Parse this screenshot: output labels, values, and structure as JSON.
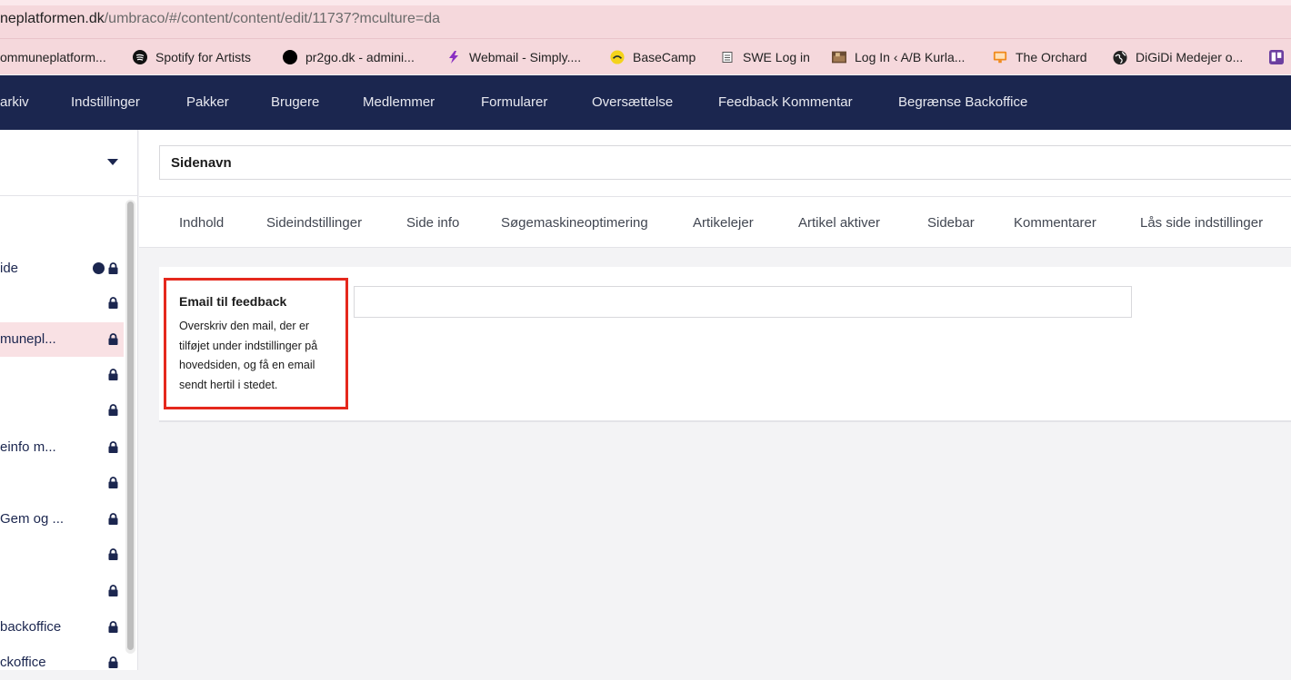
{
  "browser": {
    "url_domain": "neplatformen.dk",
    "url_path": "/umbraco/#/content/content/edit/11737?mculture=da",
    "bookmarks": [
      {
        "label": "ommuneplatform...",
        "icon": "none"
      },
      {
        "label": "Spotify for Artists",
        "icon": "spotify-icon"
      },
      {
        "label": "pr2go.dk - admini...",
        "icon": "black-circle-icon"
      },
      {
        "label": "Webmail - Simply....",
        "icon": "lightning-icon"
      },
      {
        "label": "BaseCamp",
        "icon": "basecamp-icon"
      },
      {
        "label": "SWE Log in",
        "icon": "document-icon"
      },
      {
        "label": "Log In ‹ A/B Kurla...",
        "icon": "photo-icon"
      },
      {
        "label": "The Orchard",
        "icon": "monitor-icon"
      },
      {
        "label": "DiGiDi Medejer o...",
        "icon": "globe-icon"
      }
    ]
  },
  "topnav": {
    "items": [
      "arkiv",
      "Indstillinger",
      "Pakker",
      "Brugere",
      "Medlemmer",
      "Formularer",
      "Oversættelse",
      "Feedback Kommentar",
      "Begrænse Backoffice"
    ]
  },
  "tree": {
    "nodes": [
      {
        "label": "ide",
        "locked": true,
        "globe": true,
        "active": false
      },
      {
        "label": "",
        "locked": true,
        "globe": false,
        "active": false
      },
      {
        "label": "munepl...",
        "locked": true,
        "globe": false,
        "active": true
      },
      {
        "label": "",
        "locked": true,
        "globe": false,
        "active": false
      },
      {
        "label": "",
        "locked": true,
        "globe": false,
        "active": false
      },
      {
        "label": "einfo m...",
        "locked": true,
        "globe": false,
        "active": false
      },
      {
        "label": "",
        "locked": true,
        "globe": false,
        "active": false
      },
      {
        "label": "Gem og ...",
        "locked": true,
        "globe": false,
        "active": false
      },
      {
        "label": "",
        "locked": true,
        "globe": false,
        "active": false
      },
      {
        "label": "",
        "locked": true,
        "globe": false,
        "active": false
      },
      {
        "label": "backoffice",
        "locked": true,
        "globe": false,
        "active": false
      },
      {
        "label": "ckoffice",
        "locked": true,
        "globe": false,
        "active": false
      }
    ]
  },
  "editor": {
    "name_value": "Sidenavn",
    "tabs": [
      "Indhold",
      "Sideindstillinger",
      "Side info",
      "Søgemaskineoptimering",
      "Artikelejer",
      "Artikel aktiver",
      "Sidebar",
      "Kommentarer",
      "Lås side indstillinger"
    ],
    "property": {
      "label": "Email til feedback",
      "description": "Overskriv den mail, der er tilføjet under indstillinger på hovedsiden, og få en email sendt hertil i stedet.",
      "value": ""
    }
  },
  "colors": {
    "nav_bg": "#1b264f",
    "chrome_bg": "#f5d8dc",
    "highlight": "#e5281d",
    "active_node": "#f9e1e4"
  }
}
